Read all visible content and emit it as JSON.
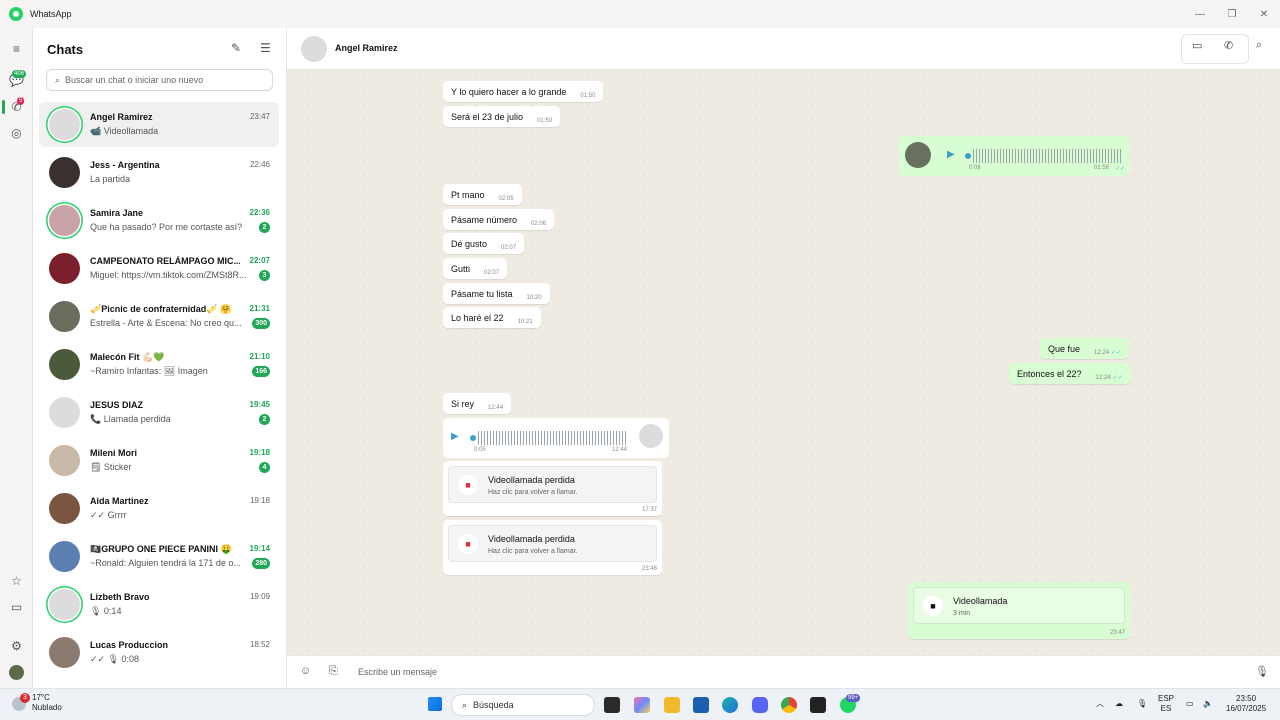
{
  "window": {
    "title": "WhatsApp"
  },
  "rail": {
    "chats_badge": "406",
    "calls_badge": "5"
  },
  "chats_panel": {
    "title": "Chats",
    "search_placeholder": "Buscar un chat o iniciar uno nuevo",
    "items": [
      {
        "name": "Angel Ramirez",
        "time": "23:47",
        "preview": "📹 Videollamada",
        "unread": "",
        "avatar_color": "#dcdcdc"
      },
      {
        "name": "Jess - Argentina",
        "time": "22:46",
        "preview": "La partida",
        "unread": "",
        "avatar_color": "#3b3030"
      },
      {
        "name": "Samira Jane",
        "time": "22:36",
        "preview": "Que ha pasado? Por me cortaste así?",
        "unread": "2",
        "avatar_color": "#c9a3a8"
      },
      {
        "name": "CAMPEONATO RELÁMPAGO MIC...",
        "time": "22:07",
        "preview": "Miguel: https://vm.tiktok.com/ZMSt8R...",
        "unread": "3",
        "avatar_color": "#7a1f2b"
      },
      {
        "name": "🎺Picnic de confraternidad🎺 🤗",
        "time": "21:31",
        "preview": "Estrella - Arte & Escena: No creo qu...",
        "unread": "300",
        "avatar_color": "#6b6b5e"
      },
      {
        "name": "Malecón Fit 💪🏻💚",
        "time": "21:10",
        "preview": "~Ramiro Infantas: 🖼 Imagen",
        "unread": "166",
        "avatar_color": "#4a5a3a"
      },
      {
        "name": "JESUS DIAZ",
        "time": "19:45",
        "preview": "📞 Llamada perdida",
        "unread": "2",
        "avatar_color": "#dcdcdc"
      },
      {
        "name": "Mileni Mori",
        "time": "19:18",
        "preview": "🗒 Sticker",
        "unread": "4",
        "avatar_color": "#c8b8a8"
      },
      {
        "name": "Aida Martinez",
        "time": "19:18",
        "preview": "✓✓ Grrrr",
        "unread": "",
        "avatar_color": "#7a5540"
      },
      {
        "name": "🏴‍☠️GRUPO ONE PIECE PANINI 🤑",
        "time": "19:14",
        "preview": "~Ronald: Alguien tendrá la 171 de o...",
        "unread": "280",
        "avatar_color": "#5a7fb0"
      },
      {
        "name": "Lizbeth Bravo",
        "time": "19:09",
        "preview": "🎙 0:14",
        "unread": "",
        "avatar_color": "#dcdcdc"
      },
      {
        "name": "Lucas Produccion",
        "time": "18:52",
        "preview": "✓✓ 🎙 0:08",
        "unread": "",
        "avatar_color": "#8a7a70"
      }
    ]
  },
  "conversation": {
    "contact_name": "Angel Ramirez",
    "composer_placeholder": "Escribe un mensaje",
    "messages": [
      {
        "dir": "in",
        "text": "Y lo quiero hacer a lo grande",
        "time": "01:50"
      },
      {
        "dir": "in",
        "text": "Será el 23 de julio",
        "time": "01:50"
      },
      {
        "dir": "out",
        "type": "voice",
        "duration": "0:08",
        "time": "01:58"
      },
      {
        "dir": "in",
        "text": "Pt mano",
        "time": "02:05"
      },
      {
        "dir": "in",
        "text": "Pásame número",
        "time": "02:06"
      },
      {
        "dir": "in",
        "text": "Dé gusto",
        "time": "02:07"
      },
      {
        "dir": "in",
        "text": "Gutti",
        "time": "02:07"
      },
      {
        "dir": "in",
        "text": "Pásame tu lista",
        "time": "10:20"
      },
      {
        "dir": "in",
        "text": "Lo haré el 22",
        "time": "10:21"
      },
      {
        "dir": "out",
        "text": "Que fue",
        "time": "12:24"
      },
      {
        "dir": "out",
        "text": "Entonces el 22?",
        "time": "12:24"
      },
      {
        "dir": "in",
        "text": "Si rey",
        "time": "12:44"
      },
      {
        "dir": "in",
        "type": "voice",
        "duration": "0:05",
        "time": "12:44"
      },
      {
        "dir": "in",
        "type": "call",
        "title": "Videollamada perdida",
        "subtitle": "Haz clic para volver a llamar.",
        "time": "17:37"
      },
      {
        "dir": "in",
        "type": "call",
        "title": "Videollamada perdida",
        "subtitle": "Haz clic para volver a llamar.",
        "time": "23:46"
      },
      {
        "dir": "out",
        "type": "call",
        "title": "Videollamada",
        "subtitle": "3 min",
        "time": "23:47"
      }
    ]
  },
  "taskbar": {
    "weather_temp": "17°C",
    "weather_desc": "Nublado",
    "weather_badge": "3",
    "search_label": "Búsqueda",
    "lang_top": "ESP",
    "lang_bottom": "ES",
    "clock_time": "23:50",
    "clock_date": "16/07/2025",
    "wa_badge": "99+"
  },
  "colors": {
    "accent": "#25d366",
    "outgoing_bubble": "#d9fdd3",
    "chat_bg": "#efeae2"
  }
}
